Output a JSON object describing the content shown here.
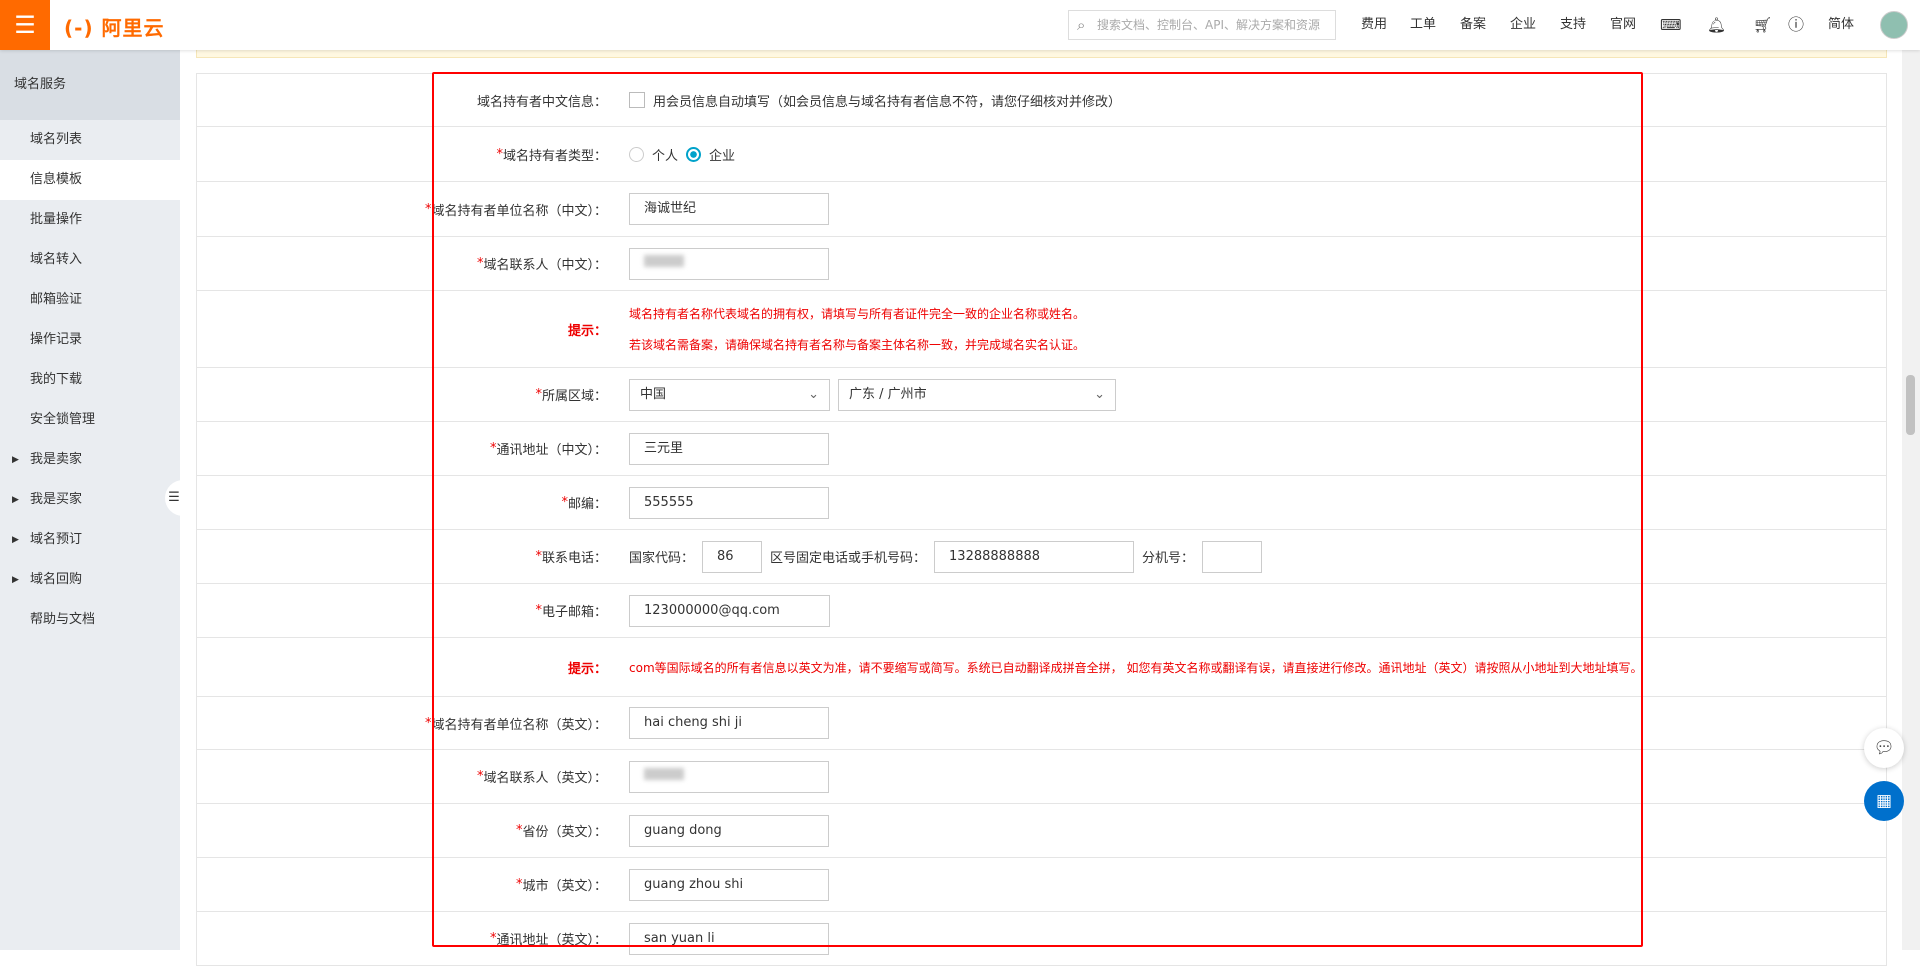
{
  "header": {
    "logo": "(-) 阿里云",
    "search_placeholder": "搜索文档、控制台、API、解决方案和资源",
    "nav": [
      "费用",
      "工单",
      "备案",
      "企业",
      "支持",
      "官网"
    ],
    "lang": "简体"
  },
  "sidebar": {
    "title": "域名服务",
    "items": [
      "域名列表",
      "信息模板",
      "批量操作",
      "域名转入",
      "邮箱验证",
      "操作记录",
      "我的下载",
      "安全锁管理"
    ],
    "groups": [
      "我是卖家",
      "我是买家",
      "域名预订",
      "域名回购"
    ],
    "help": "帮助与文档"
  },
  "form": {
    "autofill_label": "域名持有者中文信息：",
    "autofill_text": "用会员信息自动填写（如会员信息与域名持有者信息不符，请您仔细核对并修改）",
    "type_label": "域名持有者类型：",
    "type_options": [
      "个人",
      "企业"
    ],
    "type_selected": "企业",
    "org_cn_label": "域名持有者单位名称（中文）：",
    "org_cn": "海诚世纪",
    "contact_cn_label": "域名联系人（中文）：",
    "tip_label": "提示：",
    "tip1": "域名持有者名称代表域名的拥有权，请填写与所有者证件完全一致的企业名称或姓名。",
    "tip2": "若该域名需备案，请确保域名持有者名称与备案主体名称一致，并完成域名实名认证。",
    "region_label": "所属区域：",
    "country": "中国",
    "province_city": "广东 / 广州市",
    "addr_cn_label": "通讯地址（中文）：",
    "addr_cn": "三元里",
    "zip_label": "邮编：",
    "zip": "555555",
    "phone_label": "联系电话：",
    "country_code_label": "国家代码：",
    "country_code": "86",
    "phone_num_label": "区号固定电话或手机号码：",
    "phone": "13288888888",
    "ext_label": "分机号：",
    "email_label": "电子邮箱：",
    "email": "123000000@qq.com",
    "tip3": "com等国际域名的所有者信息以英文为准，请不要缩写或简写。系统已自动翻译成拼音全拼， 如您有英文名称或翻译有误，请直接进行修改。通讯地址（英文）请按照从小地址到大地址填写。",
    "org_en_label": "域名持有者单位名称（英文）：",
    "org_en": "hai cheng shi ji",
    "contact_en_label": "域名联系人（英文）：",
    "province_en_label": "省份（英文）：",
    "province_en": "guang dong",
    "city_en_label": "城市（英文）：",
    "city_en": "guang zhou shi",
    "addr_en_label": "通讯地址（英文）：",
    "addr_en": "san yuan li"
  }
}
